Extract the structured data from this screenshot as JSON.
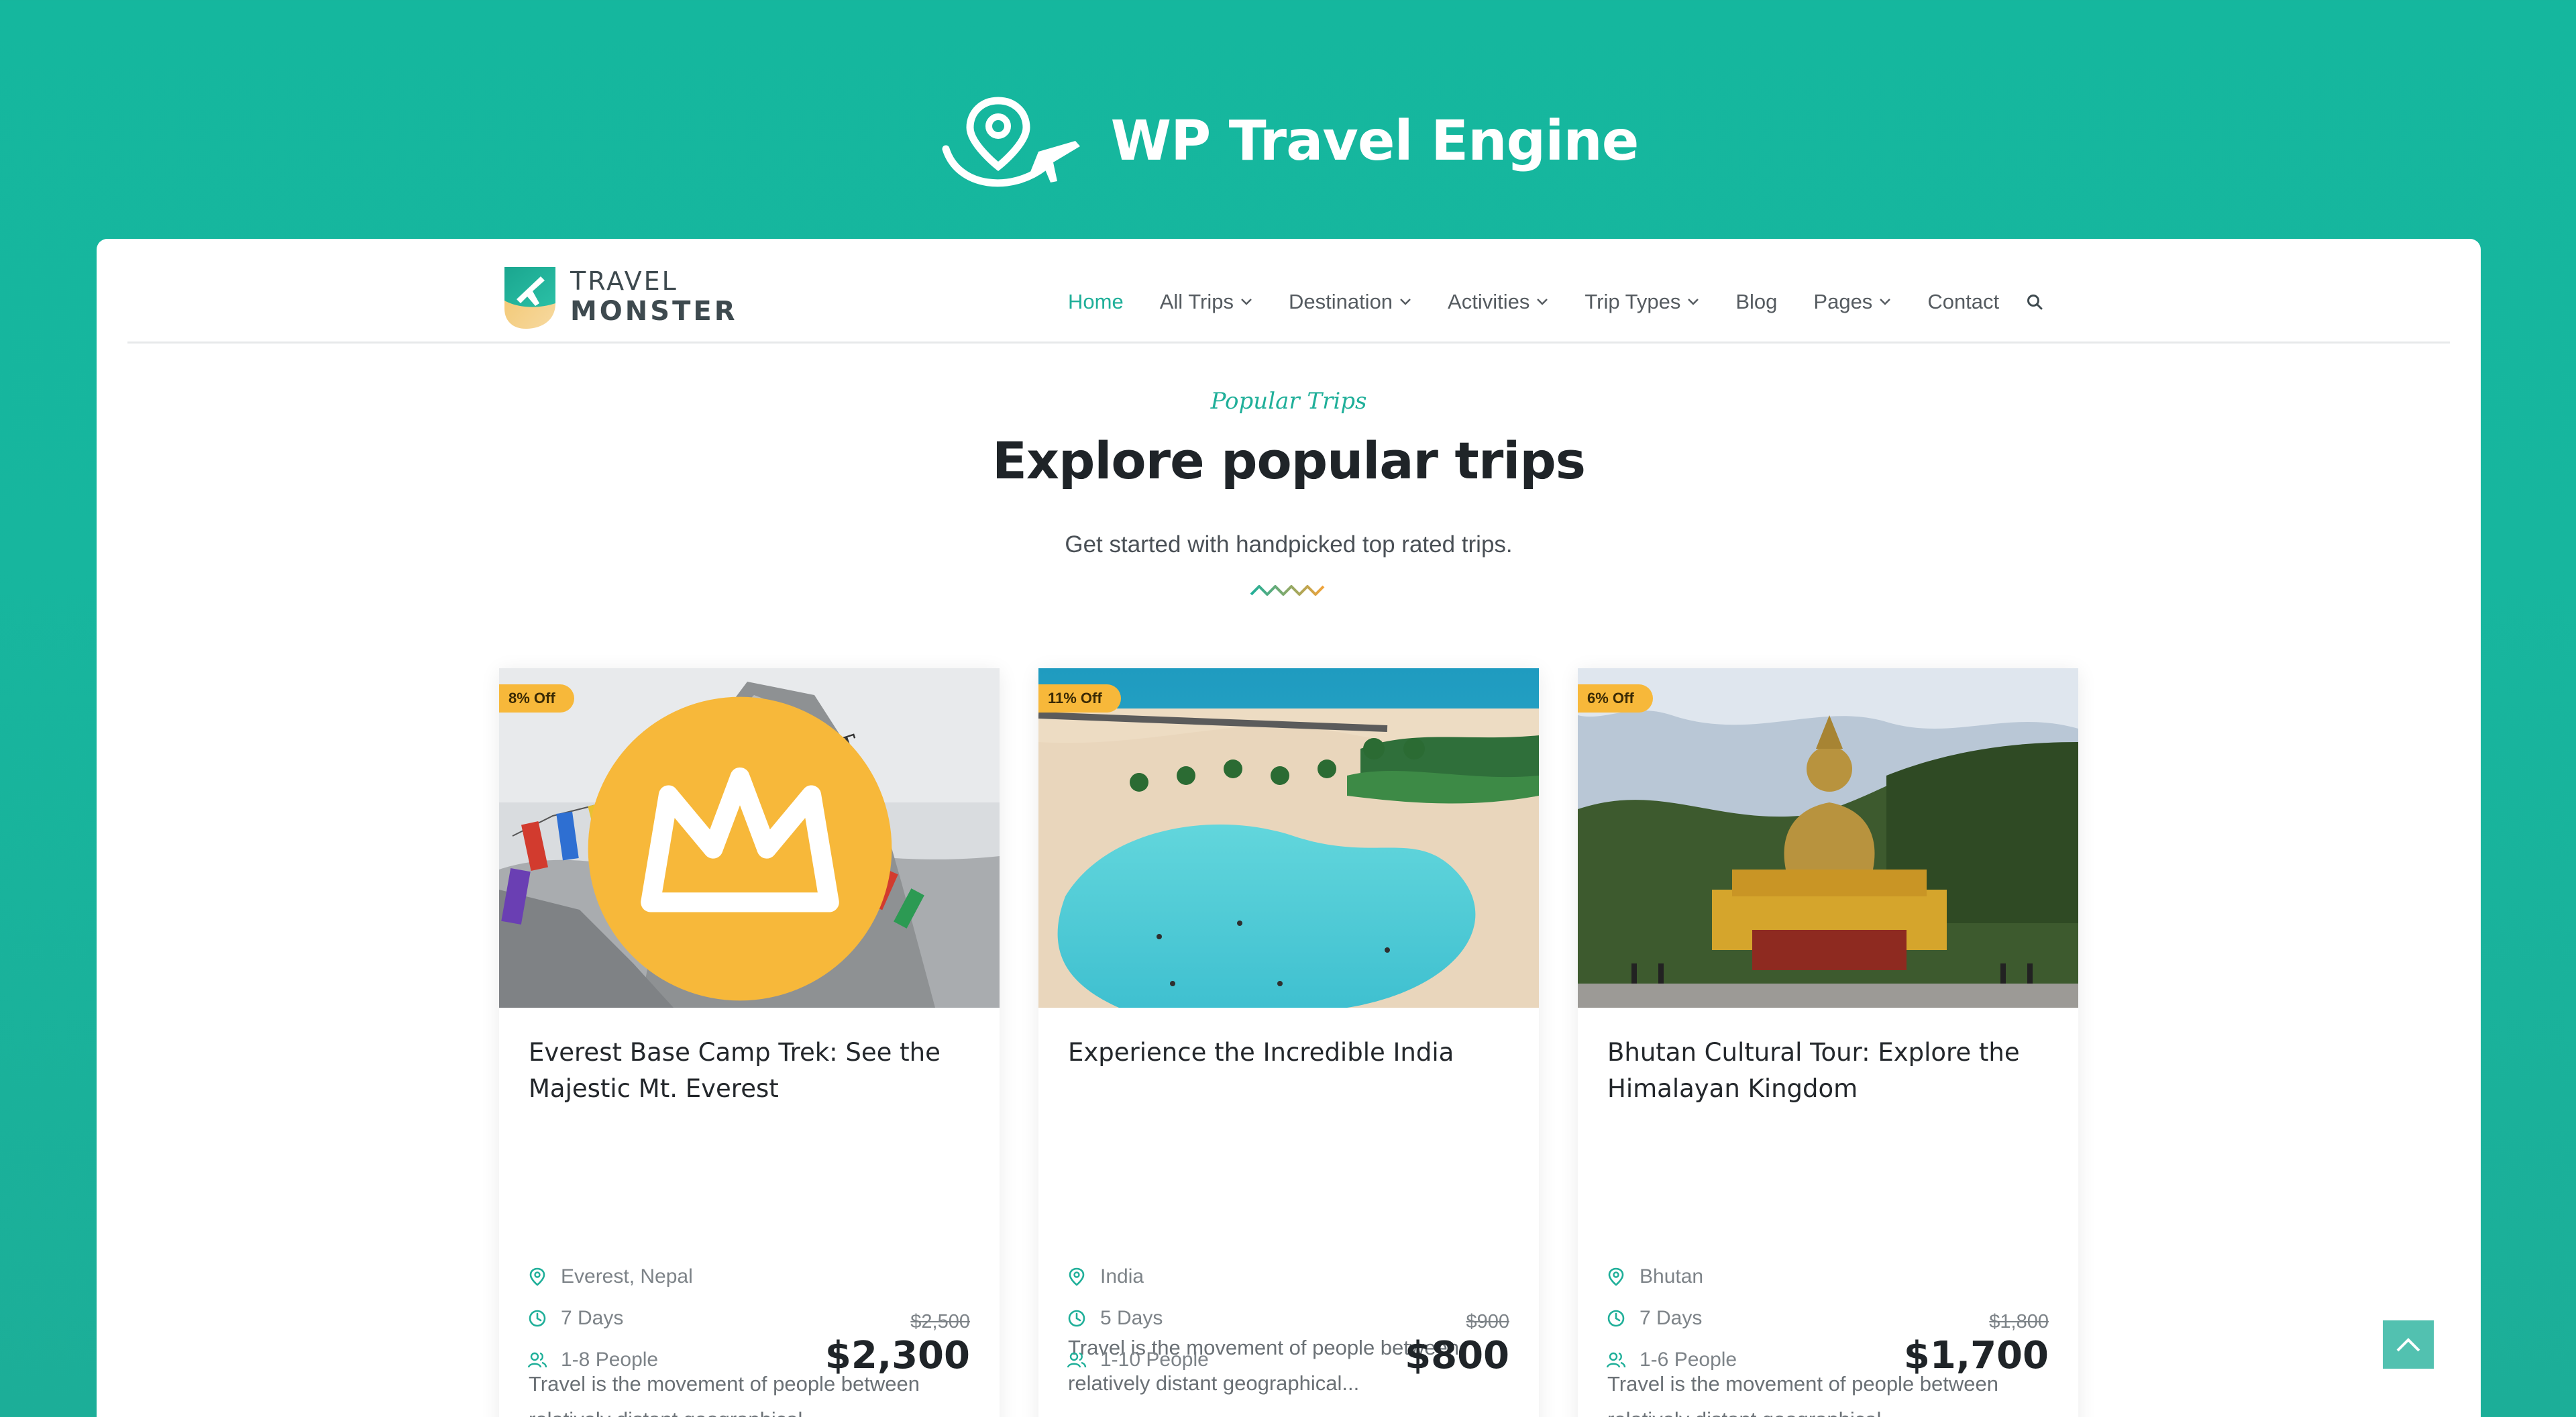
{
  "brand": {
    "name": "WP Travel Engine"
  },
  "site": {
    "logo_top": "TRAVEL",
    "logo_bottom": "MONSTER",
    "nav": [
      {
        "label": "Home",
        "active": true,
        "dropdown": false
      },
      {
        "label": "All Trips",
        "dropdown": true
      },
      {
        "label": "Destination",
        "dropdown": true
      },
      {
        "label": "Activities",
        "dropdown": true
      },
      {
        "label": "Trip Types",
        "dropdown": true
      },
      {
        "label": "Blog",
        "dropdown": false
      },
      {
        "label": "Pages",
        "dropdown": true
      },
      {
        "label": "Contact",
        "dropdown": false
      }
    ],
    "search_icon": "search-icon"
  },
  "section": {
    "kicker": "Popular Trips",
    "title": "Explore popular trips",
    "subtitle": "Get started with handpicked top rated trips."
  },
  "trips": [
    {
      "badge": "8% Off",
      "featured": true,
      "title": "Everest Base Camp Trek: See the Majestic Mt. Everest",
      "description": "Travel is the movement of people between relatively distant geographical...",
      "location": "Everest, Nepal",
      "duration": "7 Days",
      "group": "1-8 People",
      "old_price": "$2,500",
      "price": "$2,300"
    },
    {
      "badge": "11% Off",
      "featured": false,
      "title": "Experience the Incredible India",
      "description": "Travel is the movement of people between relatively distant geographical...",
      "location": "India",
      "duration": "5 Days",
      "group": "1-10 People",
      "old_price": "$900",
      "price": "$800"
    },
    {
      "badge": "6% Off",
      "featured": false,
      "title": "Bhutan Cultural Tour: Explore the Himalayan Kingdom",
      "description": "Travel is the movement of people between relatively distant geographical...",
      "location": "Bhutan",
      "duration": "7 Days",
      "group": "1-6 People",
      "old_price": "$1,800",
      "price": "$1,700"
    }
  ],
  "colors": {
    "background": "#15b79e",
    "accent": "#1faf99",
    "badge": "#f7b83a",
    "text_dark": "#1f2428"
  }
}
